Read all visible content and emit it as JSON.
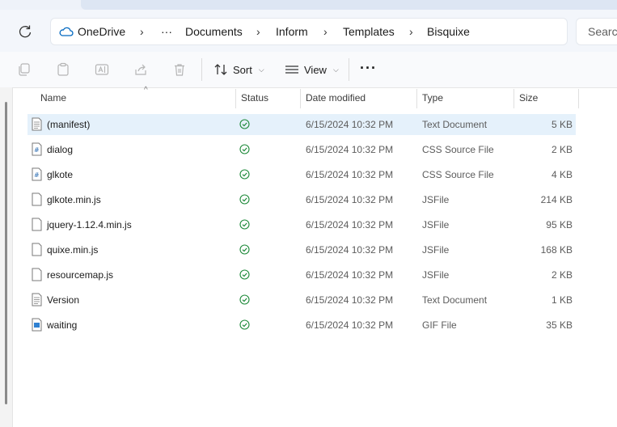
{
  "breadcrumb": {
    "root": "OneDrive",
    "overflow": "···",
    "items": [
      "Documents",
      "Inform",
      "Templates",
      "Bisquixe"
    ],
    "separator": "›"
  },
  "search": {
    "placeholder": "Search"
  },
  "toolbar": {
    "sort_label": "Sort",
    "view_label": "View",
    "more_label": "···"
  },
  "columns": {
    "name": "Name",
    "status": "Status",
    "date": "Date modified",
    "type": "Type",
    "size": "Size"
  },
  "files": [
    {
      "name": "(manifest)",
      "date": "6/15/2024 10:32 PM",
      "type": "Text Document",
      "size": "5 KB",
      "icon": "text-file-icon",
      "selected": true
    },
    {
      "name": "dialog",
      "date": "6/15/2024 10:32 PM",
      "type": "CSS Source File",
      "size": "2 KB",
      "icon": "css-file-icon"
    },
    {
      "name": "glkote",
      "date": "6/15/2024 10:32 PM",
      "type": "CSS Source File",
      "size": "4 KB",
      "icon": "css-file-icon"
    },
    {
      "name": "glkote.min.js",
      "date": "6/15/2024 10:32 PM",
      "type": "JSFile",
      "size": "214 KB",
      "icon": "blank-file-icon"
    },
    {
      "name": "jquery-1.12.4.min.js",
      "date": "6/15/2024 10:32 PM",
      "type": "JSFile",
      "size": "95 KB",
      "icon": "blank-file-icon"
    },
    {
      "name": "quixe.min.js",
      "date": "6/15/2024 10:32 PM",
      "type": "JSFile",
      "size": "168 KB",
      "icon": "blank-file-icon"
    },
    {
      "name": "resourcemap.js",
      "date": "6/15/2024 10:32 PM",
      "type": "JSFile",
      "size": "2 KB",
      "icon": "blank-file-icon"
    },
    {
      "name": "Version",
      "date": "6/15/2024 10:32 PM",
      "type": "Text Document",
      "size": "1 KB",
      "icon": "text-file-icon"
    },
    {
      "name": "waiting",
      "date": "6/15/2024 10:32 PM",
      "type": "GIF File",
      "size": "35 KB",
      "icon": "image-file-icon"
    }
  ],
  "colors": {
    "selected_row": "#e5f1fb",
    "status_synced": "#1e8a3a",
    "accent": "#0067c0"
  }
}
